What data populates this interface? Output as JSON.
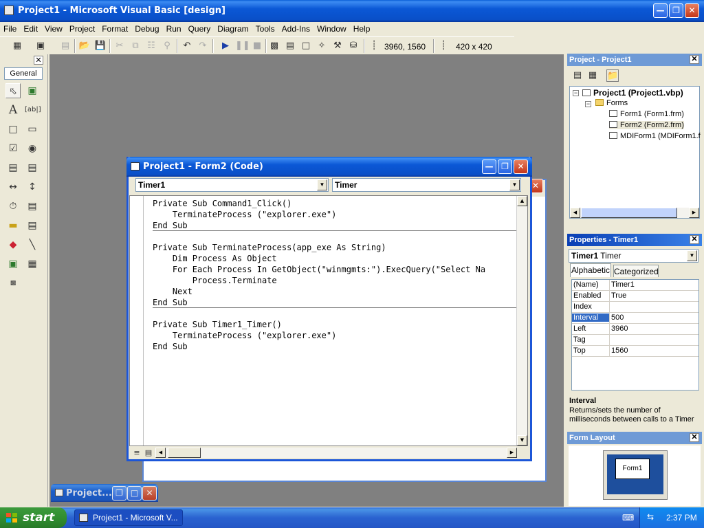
{
  "app": {
    "title": "Project1 - Microsoft Visual Basic [design]"
  },
  "menu": [
    "File",
    "Edit",
    "View",
    "Project",
    "Format",
    "Debug",
    "Run",
    "Query",
    "Diagram",
    "Tools",
    "Add-Ins",
    "Window",
    "Help"
  ],
  "toolbar": {
    "position_readout": "3960, 1560",
    "size_readout": "420 x 420"
  },
  "toolbox": {
    "tab_label": "General"
  },
  "code_window": {
    "title": "Project1 - Form2 (Code)",
    "object_combo": "Timer1",
    "procedure_combo": "Timer",
    "lines": [
      "Private Sub Command1_Click()",
      "    TerminateProcess (\"explorer.exe\")",
      "End Sub",
      "",
      "Private Sub TerminateProcess(app_exe As String)",
      "    Dim Process As Object",
      "    For Each Process In GetObject(\"winmgmts:\").ExecQuery(\"Select Na",
      "        Process.Terminate",
      "    Next",
      "End Sub",
      "",
      "Private Sub Timer1_Timer()",
      "    TerminateProcess (\"explorer.exe\")",
      "End Sub"
    ]
  },
  "minimized_window": {
    "title": "Project..."
  },
  "project_pane": {
    "title": "Project - Project1",
    "root": "Project1 (Project1.vbp)",
    "folder": "Forms",
    "items": [
      "Form1 (Form1.frm)",
      "Form2 (Form2.frm)",
      "MDIForm1 (MDIForm1.f"
    ]
  },
  "properties_pane": {
    "title": "Properties - Timer1",
    "object_name": "Timer1",
    "object_type": "Timer",
    "tabs": [
      "Alphabetic",
      "Categorized"
    ],
    "rows": [
      {
        "name": "(Name)",
        "value": "Timer1"
      },
      {
        "name": "Enabled",
        "value": "True"
      },
      {
        "name": "Index",
        "value": ""
      },
      {
        "name": "Interval",
        "value": "500"
      },
      {
        "name": "Left",
        "value": "3960"
      },
      {
        "name": "Tag",
        "value": ""
      },
      {
        "name": "Top",
        "value": "1560"
      }
    ],
    "desc_title": "Interval",
    "desc_text": "Returns/sets the number of milliseconds between calls to a Timer"
  },
  "form_layout_pane": {
    "title": "Form Layout",
    "form_label": "Form1"
  },
  "taskbar": {
    "start_label": "start",
    "task_label": "Project1 - Microsoft V...",
    "clock": "2:37 PM"
  },
  "colors": {
    "xp_blue": "#0a4fc7",
    "mdi_gray": "#808080",
    "start_green": "#2f8b2f"
  }
}
